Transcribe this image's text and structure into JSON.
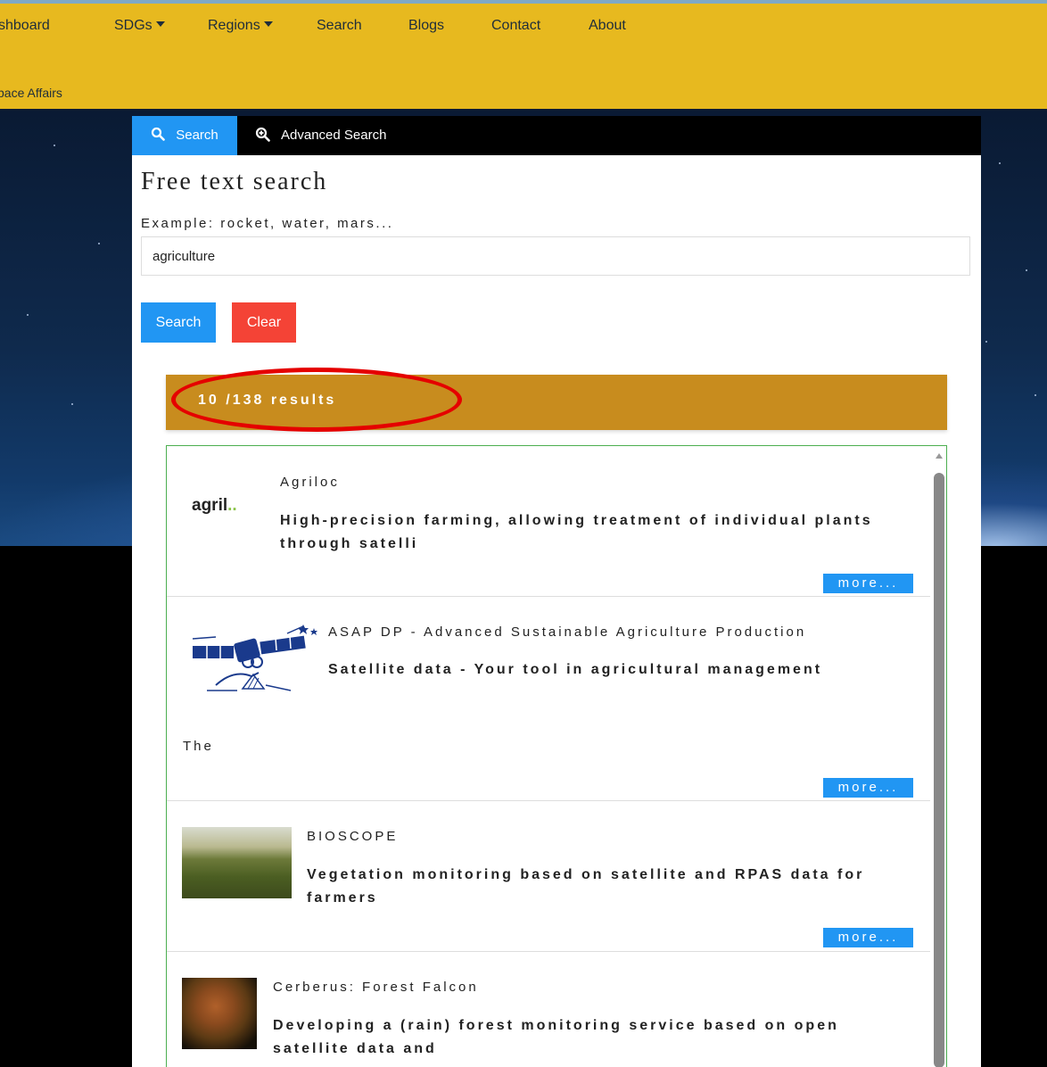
{
  "nav": {
    "items": [
      {
        "label": "shboard",
        "dropdown": false
      },
      {
        "label": "SDGs",
        "dropdown": true
      },
      {
        "label": "Regions",
        "dropdown": true
      },
      {
        "label": "Search",
        "dropdown": false
      },
      {
        "label": "Blogs",
        "dropdown": false
      },
      {
        "label": "Contact",
        "dropdown": false
      },
      {
        "label": "About",
        "dropdown": false
      }
    ],
    "subtitle": "pace Affairs"
  },
  "tabs": {
    "search": "Search",
    "advanced": "Advanced Search"
  },
  "search": {
    "title": "Free text search",
    "example": "Example: rocket, water, mars...",
    "value": "agriculture",
    "search_button": "Search",
    "clear_button": "Clear"
  },
  "results": {
    "count": "10 /138 results",
    "items": [
      {
        "name": "Agriloc",
        "logo_text": "agril",
        "description": "High-precision farming, allowing treatment of individual plants through satelli",
        "more": "more..."
      },
      {
        "name": "ASAP DP - Advanced Sustainable Agriculture Production",
        "description": "Satellite data - Your tool in agricultural management",
        "extra": "The",
        "more": "more..."
      },
      {
        "name": "BIOSCOPE",
        "description": "Vegetation monitoring based on satellite and RPAS data for farmers",
        "more": "more..."
      },
      {
        "name": "Cerberus: Forest Falcon",
        "description": "Developing a (rain) forest monitoring service based on open satellite data and"
      }
    ]
  },
  "colors": {
    "topbar": "#e7b91f",
    "accent_blue": "#2196f3",
    "clear_red": "#f44336",
    "results_header": "#c88c1e",
    "annotation_red": "#e50000"
  }
}
